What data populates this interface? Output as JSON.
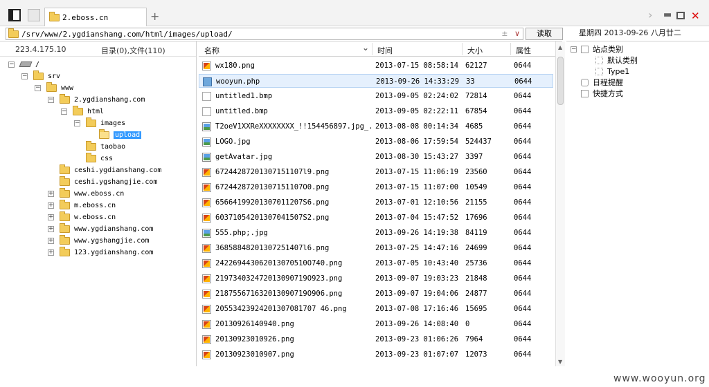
{
  "tab": {
    "title": "2.eboss.cn"
  },
  "address": {
    "path": "/srv/www/2.ygdianshang.com/html/images/upload/",
    "read_label": "读取"
  },
  "date_display": "星期四 2013-09-26 八月廿二",
  "left": {
    "ip": "223.4.175.10",
    "counts": "目录(0),文件(110)",
    "tree": [
      {
        "label": "/",
        "depth": 0,
        "toggle": "-",
        "icon": "drive"
      },
      {
        "label": "srv",
        "depth": 1,
        "toggle": "-",
        "icon": "folder"
      },
      {
        "label": "www",
        "depth": 2,
        "toggle": "-",
        "icon": "folder"
      },
      {
        "label": "2.ygdianshang.com",
        "depth": 3,
        "toggle": "-",
        "icon": "folder"
      },
      {
        "label": "html",
        "depth": 4,
        "toggle": "-",
        "icon": "folder"
      },
      {
        "label": "images",
        "depth": 5,
        "toggle": "-",
        "icon": "folder"
      },
      {
        "label": "upload",
        "depth": 6,
        "toggle": "",
        "icon": "folder-open",
        "selected": true
      },
      {
        "label": "taobao",
        "depth": 5,
        "toggle": "",
        "icon": "folder"
      },
      {
        "label": "css",
        "depth": 5,
        "toggle": "",
        "icon": "folder"
      },
      {
        "label": "ceshi.ygdianshang.com",
        "depth": 3,
        "toggle": "",
        "icon": "folder"
      },
      {
        "label": "ceshi.ygshangjie.com",
        "depth": 3,
        "toggle": "",
        "icon": "folder"
      },
      {
        "label": "www.eboss.cn",
        "depth": 3,
        "toggle": "+",
        "icon": "folder"
      },
      {
        "label": "m.eboss.cn",
        "depth": 3,
        "toggle": "+",
        "icon": "folder"
      },
      {
        "label": "w.eboss.cn",
        "depth": 3,
        "toggle": "+",
        "icon": "folder"
      },
      {
        "label": "www.ygdianshang.com",
        "depth": 3,
        "toggle": "+",
        "icon": "folder"
      },
      {
        "label": "www.ygshangjie.com",
        "depth": 3,
        "toggle": "+",
        "icon": "folder"
      },
      {
        "label": "123.ygdianshang.com",
        "depth": 3,
        "toggle": "+",
        "icon": "folder"
      }
    ]
  },
  "files": {
    "columns": {
      "name": "名称",
      "time": "时间",
      "size": "大小",
      "attr": "属性"
    },
    "rows": [
      {
        "name": "wx180.png",
        "time": "2013-07-15 08:58:14",
        "size": "62127",
        "attr": "0644",
        "type": "png"
      },
      {
        "name": "wooyun.php",
        "time": "2013-09-26 14:33:29",
        "size": "33",
        "attr": "0644",
        "type": "php",
        "selected": true
      },
      {
        "name": "untitled1.bmp",
        "time": "2013-09-05 02:24:02",
        "size": "72814",
        "attr": "0644",
        "type": "bmp"
      },
      {
        "name": "untitled.bmp",
        "time": "2013-09-05 02:22:11",
        "size": "67854",
        "attr": "0644",
        "type": "bmp"
      },
      {
        "name": "T2oeV1XXReXXXXXXXX_!!154456897.jpg_...",
        "time": "2013-08-08 00:14:34",
        "size": "4685",
        "attr": "0644",
        "type": "jpg"
      },
      {
        "name": "LOGO.jpg",
        "time": "2013-08-06 17:59:54",
        "size": "524437",
        "attr": "0644",
        "type": "jpg"
      },
      {
        "name": "getAvatar.jpg",
        "time": "2013-08-30 15:43:27",
        "size": "3397",
        "attr": "0644",
        "type": "jpg"
      },
      {
        "name": "67244287201307151107l9.png",
        "time": "2013-07-15 11:06:19",
        "size": "23560",
        "attr": "0644",
        "type": "png"
      },
      {
        "name": "67244287201307151107O0.png",
        "time": "2013-07-15 11:07:00",
        "size": "10549",
        "attr": "0644",
        "type": "png"
      },
      {
        "name": "65664199201307011207S6.png",
        "time": "2013-07-01 12:10:56",
        "size": "21155",
        "attr": "0644",
        "type": "png"
      },
      {
        "name": "60371054201307041507S2.png",
        "time": "2013-07-04 15:47:52",
        "size": "17696",
        "attr": "0644",
        "type": "png"
      },
      {
        "name": "555.php;.jpg",
        "time": "2013-09-26 14:19:38",
        "size": "84119",
        "attr": "0644",
        "type": "jpg"
      },
      {
        "name": "36858848201307251407l6.png",
        "time": "2013-07-25 14:47:16",
        "size": "24699",
        "attr": "0644",
        "type": "png"
      },
      {
        "name": "242269443062013070510O740.png",
        "time": "2013-07-05 10:43:40",
        "size": "25736",
        "attr": "0644",
        "type": "png"
      },
      {
        "name": "219734032472013090719O923.png",
        "time": "2013-09-07 19:03:23",
        "size": "21848",
        "attr": "0644",
        "type": "png"
      },
      {
        "name": "218755671632013090719O906.png",
        "time": "2013-09-07 19:04:06",
        "size": "24877",
        "attr": "0644",
        "type": "png"
      },
      {
        "name": "20553423924201307081707 46.png",
        "time": "2013-07-08 17:16:46",
        "size": "15695",
        "attr": "0644",
        "type": "png"
      },
      {
        "name": "20130926140940.png",
        "time": "2013-09-26 14:08:40",
        "size": "0",
        "attr": "0644",
        "type": "png"
      },
      {
        "name": "20130923010926.png",
        "time": "2013-09-23 01:06:26",
        "size": "7964",
        "attr": "0644",
        "type": "png"
      },
      {
        "name": "20130923010907.png",
        "time": "2013-09-23 01:07:07",
        "size": "12073",
        "attr": "0644",
        "type": "png"
      }
    ]
  },
  "right": {
    "items": [
      {
        "label": "站点类别",
        "depth": 0,
        "toggle": "-",
        "icon": "box"
      },
      {
        "label": "默认类别",
        "depth": 1,
        "toggle": "",
        "icon": "dotted"
      },
      {
        "label": "Type1",
        "depth": 1,
        "toggle": "",
        "icon": "dotted"
      },
      {
        "label": "日程提醒",
        "depth": 0,
        "toggle": "",
        "icon": "clock"
      },
      {
        "label": "快捷方式",
        "depth": 0,
        "toggle": "",
        "icon": "hand"
      }
    ]
  },
  "watermark": "www.wooyun.org"
}
